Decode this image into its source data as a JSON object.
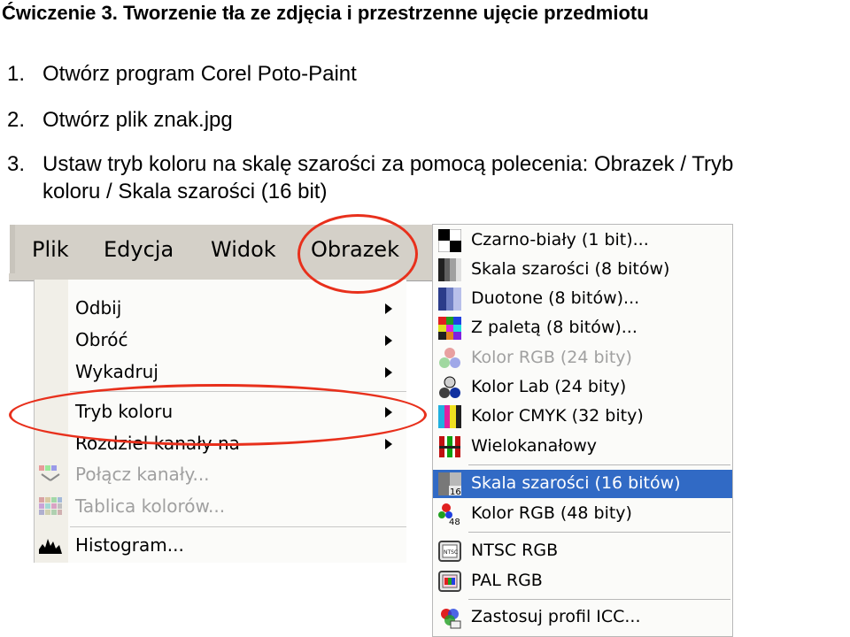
{
  "doc": {
    "title": "Ćwiczenie 3. Tworzenie tła ze zdjęcia i przestrzenne ujęcie przedmiotu",
    "steps": [
      {
        "num": "1.",
        "text": "Otwórz program Corel Poto-Paint"
      },
      {
        "num": "2.",
        "text": "Otwórz plik znak.jpg"
      },
      {
        "num": "3.",
        "text": "Ustaw tryb koloru na skalę szarości za pomocą polecenia: Obrazek / Tryb",
        "cont": "koloru / Skala szarości (16 bit)"
      }
    ]
  },
  "menubar": {
    "items": [
      "Plik",
      "Edycja",
      "Widok",
      "Obrazek"
    ]
  },
  "image_menu": {
    "items": [
      {
        "label": "Odbij",
        "disabled": false,
        "submenu": true
      },
      {
        "label": "Obróć",
        "disabled": false,
        "submenu": true
      },
      {
        "label": "Wykadruj",
        "disabled": false,
        "submenu": true
      },
      {
        "label": "Tryb koloru",
        "disabled": false,
        "submenu": true
      },
      {
        "label": "Rozdziel kanały na",
        "disabled": false,
        "submenu": true
      },
      {
        "label": "Połącz kanały...",
        "disabled": true,
        "icon": "merge-channels-icon"
      },
      {
        "label": "Tablica kolorów...",
        "disabled": true,
        "icon": "color-table-icon"
      },
      {
        "label": "Histogram...",
        "disabled": false,
        "icon": "histogram-icon"
      }
    ]
  },
  "color_mode_menu": {
    "items": [
      {
        "label": "Czarno-biały (1 bit)...",
        "icon": "black-white-icon",
        "disabled": false
      },
      {
        "label": "Skala szarości (8 bitów)",
        "icon": "grayscale-8-icon",
        "disabled": false
      },
      {
        "label": "Duotone (8 bitów)...",
        "icon": "duotone-icon",
        "disabled": false
      },
      {
        "label": "Z paletą (8 bitów)...",
        "icon": "palette-icon",
        "disabled": false
      },
      {
        "label": "Kolor RGB (24 bity)",
        "icon": "rgb-icon",
        "disabled": true
      },
      {
        "label": "Kolor Lab (24 bity)",
        "icon": "lab-icon",
        "disabled": false
      },
      {
        "label": "Kolor CMYK (32 bity)",
        "icon": "cmyk-icon",
        "disabled": false
      },
      {
        "label": "Wielokanałowy",
        "icon": "multichannel-icon",
        "disabled": false
      },
      {
        "label": "Skala szarości (16 bitów)",
        "icon": "grayscale-16-icon",
        "disabled": false,
        "selected": true,
        "badge": "16"
      },
      {
        "label": "Kolor RGB (48 bity)",
        "icon": "rgb-48-icon",
        "disabled": false,
        "badge": "48"
      },
      {
        "label": "NTSC RGB",
        "icon": "ntsc-icon",
        "disabled": false
      },
      {
        "label": "PAL RGB",
        "icon": "pal-icon",
        "disabled": false
      },
      {
        "label": "Zastosuj profil ICC...",
        "icon": "icc-profile-icon",
        "disabled": false
      }
    ]
  },
  "colors": {
    "highlight": "#316ac5",
    "annotation_ring": "#e8301c",
    "menu_bar": "#d4d0c8"
  }
}
